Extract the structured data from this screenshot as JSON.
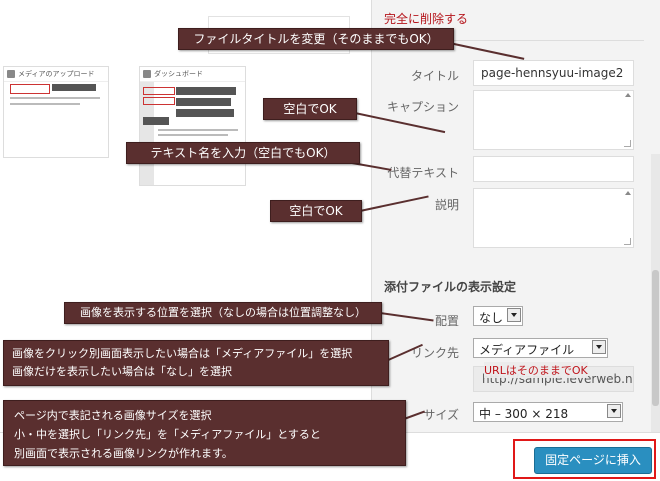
{
  "media_preview": {
    "thumb1_title": "メディアのアップロード",
    "thumb2_title": "ダッシュボード"
  },
  "details": {
    "delete_link": "完全に削除する",
    "title_label": "タイトル",
    "title_value": "page-hennsyuu-image2",
    "caption_label": "キャプション",
    "caption_value": "",
    "alt_label": "代替テキスト",
    "alt_value": "",
    "description_label": "説明",
    "description_value": ""
  },
  "display_settings": {
    "heading": "添付ファイルの表示設定",
    "align_label": "配置",
    "align_value": "なし",
    "link_label": "リンク先",
    "link_value": "メディアファイル",
    "link_url": "http://sample.leverweb.net/",
    "size_label": "サイズ",
    "size_value": "中 – 300 × 218"
  },
  "footer": {
    "insert_button": "固定ページに挿入"
  },
  "annotations": {
    "title_note": "ファイルタイトルを変更（そのままでもOK）",
    "caption_note": "空白でOK",
    "alt_note": "テキスト名を入力（空白でもOK）",
    "description_note": "空白でOK",
    "align_note": "画像を表示する位置を選択（なしの場合は位置調整なし）",
    "link_note_line1": "画像をクリック別画面表示したい場合は「メディアファイル」を選択",
    "link_note_line2": "画像だけを表示したい場合は「なし」を選択",
    "url_note": "URLはそのままでOK",
    "size_note_line1": "ページ内で表記される画像サイズを選択",
    "size_note_line2": "小・中を選択し「リンク先」を「メディアファイル」とすると",
    "size_note_line3": "別画面で表示される画像リンクが作れます。"
  },
  "colors": {
    "callout_bg": "#5a2f2f",
    "delete_link": "#b5141b",
    "primary_button": "#2a8fc0",
    "highlight_frame": "#e01818",
    "url_note": "#c0141b"
  }
}
